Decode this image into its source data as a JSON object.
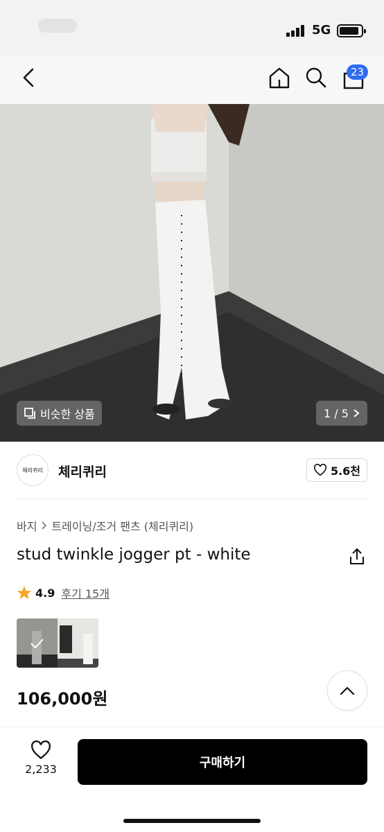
{
  "status_bar": {
    "network": "5G"
  },
  "nav": {
    "cart_count": "23",
    "icons": [
      "back-icon",
      "home-icon",
      "search-icon",
      "cart-icon"
    ]
  },
  "hero": {
    "similar_label": "비슷한 상품",
    "pager": "1 / 5"
  },
  "brand": {
    "logo_text": "체리퀴리",
    "name": "체리퀴리",
    "likes": "5.6천"
  },
  "product": {
    "breadcrumb": [
      "바지",
      "트레이닝/조거 팬츠 (체리퀴리)"
    ],
    "title": "stud twinkle jogger pt - white",
    "rating": "4.9",
    "reviews": "후기 15개",
    "price": "106,000원"
  },
  "bottom": {
    "wish_count": "2,233",
    "buy_label": "구매하기"
  },
  "colors": {
    "accent_badge": "#2f6cf4",
    "star": "#f5a623",
    "buy_button": "#000000"
  }
}
